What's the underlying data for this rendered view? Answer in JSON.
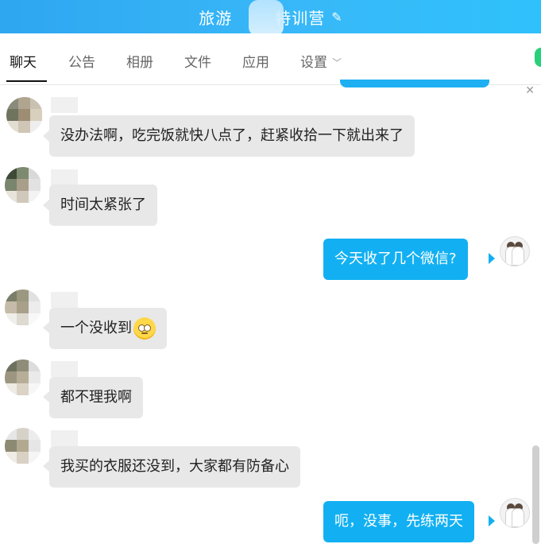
{
  "header": {
    "title_left": "旅游",
    "title_right": "特训营"
  },
  "tabs": [
    {
      "label": "聊天"
    },
    {
      "label": "公告"
    },
    {
      "label": "相册"
    },
    {
      "label": "文件"
    },
    {
      "label": "应用"
    },
    {
      "label": "设置"
    }
  ],
  "messages": [
    {
      "side": "left",
      "text": "没办法啊，吃完饭就快八点了，赶紧收拾一下就出来了"
    },
    {
      "side": "left",
      "text": "时间太紧张了"
    },
    {
      "side": "right",
      "text": "今天收了几个微信?"
    },
    {
      "side": "left",
      "text": "一个没收到"
    },
    {
      "side": "left",
      "text": "都不理我啊"
    },
    {
      "side": "left",
      "text": "我买的衣服还没到，大家都有防备心"
    },
    {
      "side": "right",
      "text": "呃，没事，先练两天"
    }
  ],
  "colors": {
    "accent": "#12b0f2",
    "header_start": "#2ea6f0",
    "header_end": "#2fc1fb",
    "bubble_left": "#e8e8e8"
  }
}
